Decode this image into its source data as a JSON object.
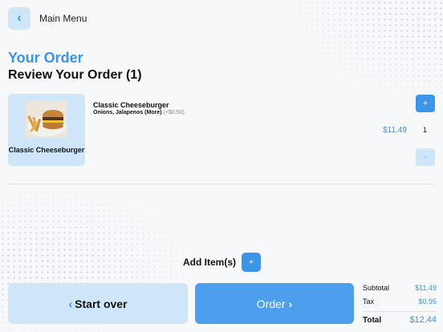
{
  "header": {
    "back_icon": "chevron-left-icon",
    "menu_label": "Main Menu"
  },
  "order": {
    "heading": "Your Order",
    "review_title": "Review Your Order (1)"
  },
  "items": [
    {
      "card_label": "Classic Cheeseburger",
      "image": "cheeseburger-with-fries-photo",
      "name": "Classic Cheeseburger",
      "modifiers": "Onions, Jalapenos (More)",
      "modifier_price": "(+$0.50)",
      "price": "$11.49",
      "quantity": "1",
      "plus_label": "+",
      "minus_label": "-"
    }
  ],
  "add_items": {
    "label": "Add Item(s)",
    "button_label": "+"
  },
  "actions": {
    "start_over": "Start over",
    "order": "Order"
  },
  "totals": {
    "subtotal_label": "Subtotal",
    "subtotal": "$11.49",
    "tax_label": "Tax",
    "tax": "$0.95",
    "total_label": "Total",
    "total": "$12.44"
  },
  "colors": {
    "accent": "#3d95e8",
    "light_accent": "#cfe6f8",
    "background": "#f7f8fa"
  }
}
